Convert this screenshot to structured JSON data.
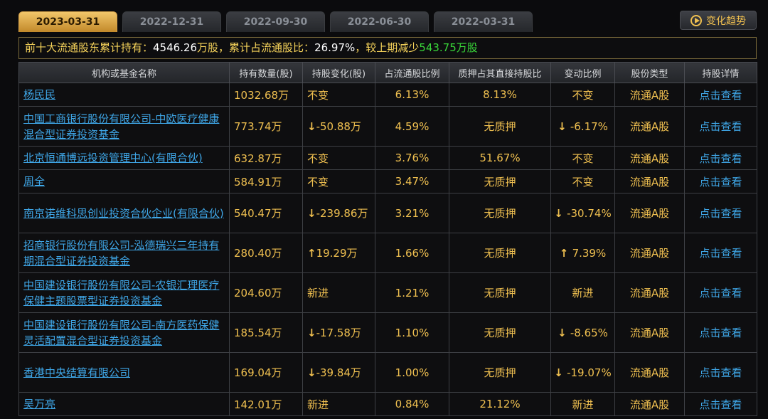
{
  "tabs": [
    {
      "label": "2023-03-31",
      "active": true
    },
    {
      "label": "2022-12-31",
      "active": false
    },
    {
      "label": "2022-09-30",
      "active": false
    },
    {
      "label": "2022-06-30",
      "active": false
    },
    {
      "label": "2022-03-31",
      "active": false
    }
  ],
  "trend_button": {
    "label": "变化趋势",
    "icon": "play-circle-icon"
  },
  "summary": {
    "prefix": "前十大流通股东累计持有：",
    "total": "4546.26",
    "unit1": "万股，累计占流通股比：",
    "ratio": "26.97%",
    "mid": "，较上期减少",
    "decrease": "543.75万股"
  },
  "columns": [
    "机构或基金名称",
    "持有数量(股)",
    "持股变化(股)",
    "占流通股比例",
    "质押占其直接持股比",
    "变动比例",
    "股份类型",
    "持股详情"
  ],
  "rows": [
    {
      "name": "杨民民",
      "amount": "1032.68万",
      "change": "不变",
      "change_dir": "same",
      "ratio": "6.13%",
      "pledge": "8.13%",
      "change_pct": "不变",
      "pct_dir": "same",
      "type": "流通A股",
      "detail": "点击查看",
      "tall": false
    },
    {
      "name": "中国工商银行股份有限公司-中欧医疗健康混合型证券投资基金",
      "amount": "773.74万",
      "change": "-50.88万",
      "change_dir": "down",
      "ratio": "4.59%",
      "pledge": "无质押",
      "change_pct": "-6.17%",
      "pct_dir": "down",
      "type": "流通A股",
      "detail": "点击查看",
      "tall": true
    },
    {
      "name": "北京恒通博远投资管理中心(有限合伙)",
      "amount": "632.87万",
      "change": "不变",
      "change_dir": "same",
      "ratio": "3.76%",
      "pledge": "51.67%",
      "change_pct": "不变",
      "pct_dir": "same",
      "type": "流通A股",
      "detail": "点击查看",
      "tall": false
    },
    {
      "name": "周全",
      "amount": "584.91万",
      "change": "不变",
      "change_dir": "same",
      "ratio": "3.47%",
      "pledge": "无质押",
      "change_pct": "不变",
      "pct_dir": "same",
      "type": "流通A股",
      "detail": "点击查看",
      "tall": false
    },
    {
      "name": "南京诺维科思创业投资合伙企业(有限合伙)",
      "amount": "540.47万",
      "change": "-239.86万",
      "change_dir": "down",
      "ratio": "3.21%",
      "pledge": "无质押",
      "change_pct": "-30.74%",
      "pct_dir": "down",
      "type": "流通A股",
      "detail": "点击查看",
      "tall": true
    },
    {
      "name": "招商银行股份有限公司-泓德瑞兴三年持有期混合型证券投资基金",
      "amount": "280.40万",
      "change": "19.29万",
      "change_dir": "up",
      "ratio": "1.66%",
      "pledge": "无质押",
      "change_pct": "7.39%",
      "pct_dir": "up",
      "type": "流通A股",
      "detail": "点击查看",
      "tall": true
    },
    {
      "name": "中国建设银行股份有限公司-农银汇理医疗保健主题股票型证券投资基金",
      "amount": "204.60万",
      "change": "新进",
      "change_dir": "new",
      "ratio": "1.21%",
      "pledge": "无质押",
      "change_pct": "新进",
      "pct_dir": "new",
      "type": "流通A股",
      "detail": "点击查看",
      "tall": true
    },
    {
      "name": "中国建设银行股份有限公司-南方医药保健灵活配置混合型证券投资基金",
      "amount": "185.54万",
      "change": "-17.58万",
      "change_dir": "down",
      "ratio": "1.10%",
      "pledge": "无质押",
      "change_pct": "-8.65%",
      "pct_dir": "down",
      "type": "流通A股",
      "detail": "点击查看",
      "tall": true
    },
    {
      "name": "香港中央结算有限公司",
      "amount": "169.04万",
      "change": "-39.84万",
      "change_dir": "down",
      "ratio": "1.00%",
      "pledge": "无质押",
      "change_pct": "-19.07%",
      "pct_dir": "down",
      "type": "流通A股",
      "detail": "点击查看",
      "tall": true
    },
    {
      "name": "吴万亮",
      "amount": "142.01万",
      "change": "新进",
      "change_dir": "new",
      "ratio": "0.84%",
      "pledge": "21.12%",
      "change_pct": "新进",
      "pct_dir": "new",
      "type": "流通A股",
      "detail": "点击查看",
      "tall": false
    }
  ],
  "colors": {
    "accent": "#f0c050",
    "link": "#3fa7e8",
    "up": "#ff2a2a",
    "down": "#39d639",
    "background": "#0b0b0d"
  }
}
